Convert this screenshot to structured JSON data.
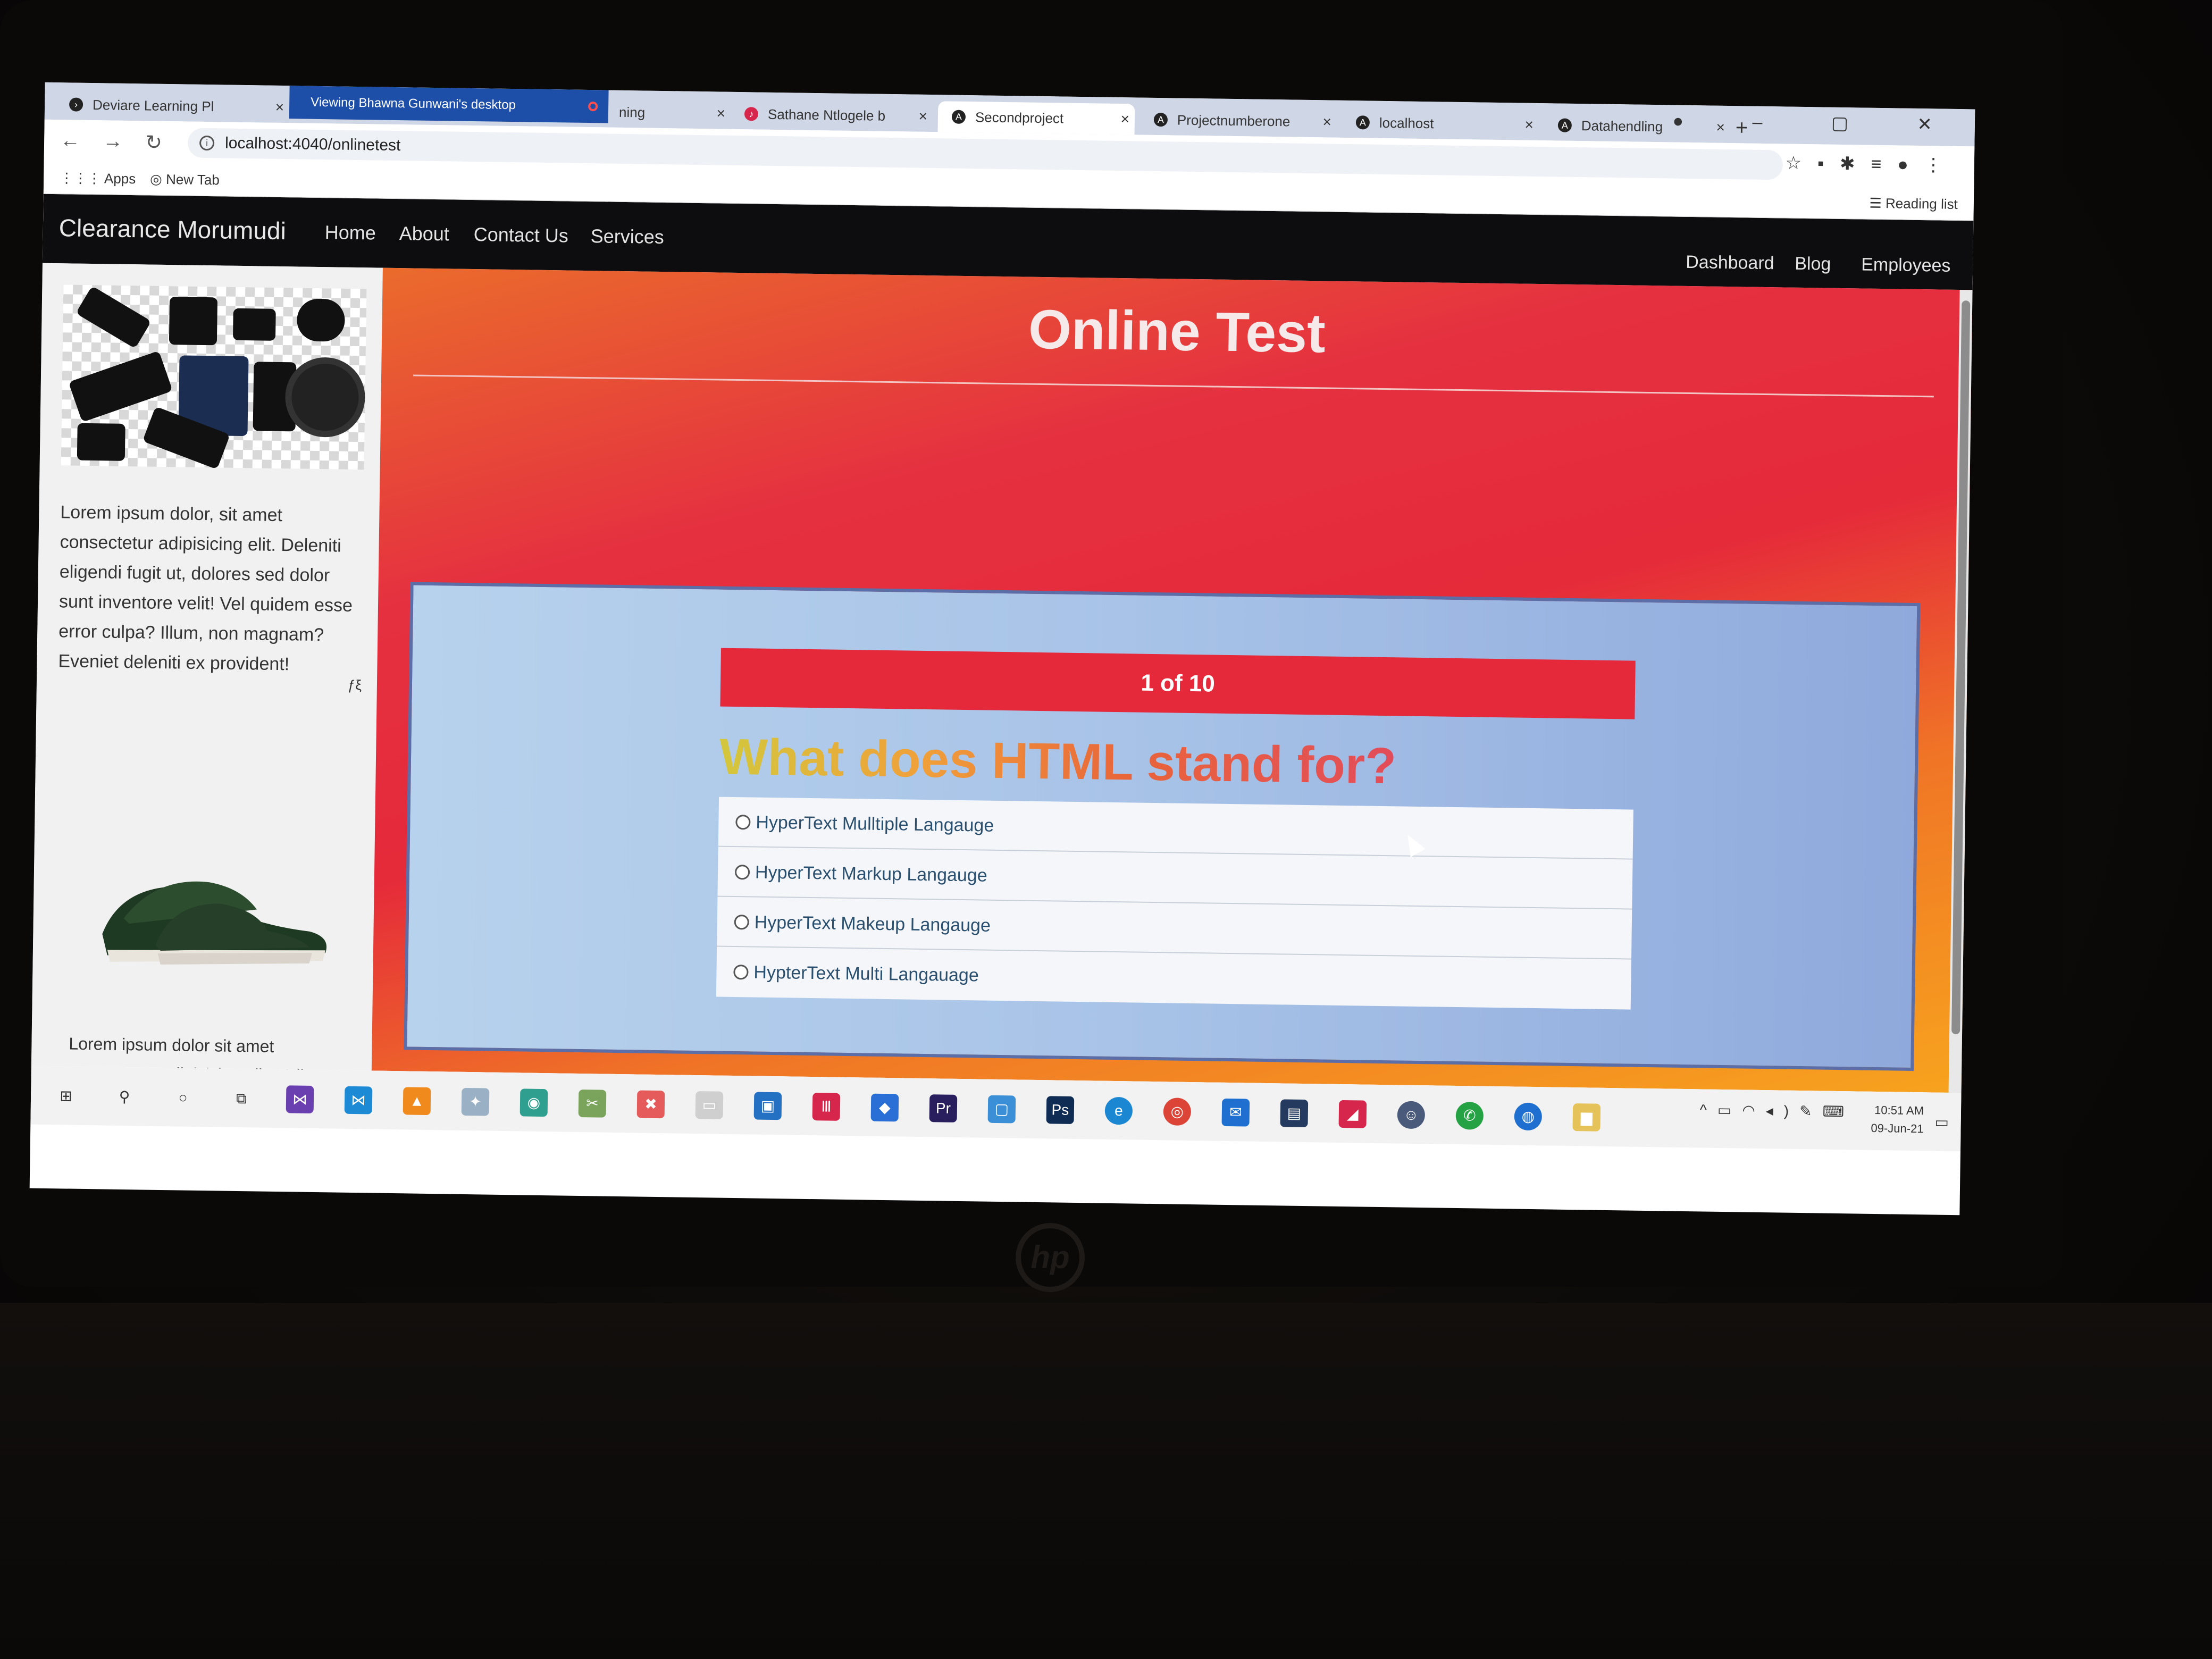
{
  "browser": {
    "tabs": [
      {
        "label": "Deviare Learning Pl",
        "favicon": "deviare-logo-icon"
      },
      {
        "label": "ning",
        "favicon": ""
      },
      {
        "label": "Sathane Ntlogele b",
        "favicon": "music-icon"
      },
      {
        "label": "Secondproject",
        "favicon": "angular-icon",
        "active": true
      },
      {
        "label": "Projectnumberone",
        "favicon": "angular-icon"
      },
      {
        "label": "localhost",
        "favicon": "angular-icon"
      },
      {
        "label": "Datahendling",
        "favicon": "angular-icon"
      }
    ],
    "share_banner": "Viewing Bhawna Gunwani's desktop",
    "url": "localhost:4040/onlinetest",
    "bookmarks": {
      "apps": "Apps",
      "new_tab": "New Tab",
      "reading_list": "Reading list"
    }
  },
  "site": {
    "brand": "Clearance Morumudi",
    "nav_left": [
      "Home",
      "About",
      "Contact Us",
      "Services"
    ],
    "nav_right": [
      "Dashboard",
      "Blog",
      "Employees"
    ]
  },
  "sidebar": {
    "text1": "Lorem ipsum dolor, sit amet consectetur adipisicing elit. Deleniti eligendi fugit ut, dolores sed dolor sunt inventore velit! Vel quidem esse error culpa? Illum, non magnam? Eveniet deleniti ex provident!",
    "text2": "Lorem ipsum dolor sit amet consectetur adipisicing elit. Velit, quo. Quidem ipsam facilis"
  },
  "main": {
    "title": "Online Test",
    "progress": "1 of 10",
    "question": "What does HTML stand for?",
    "options": [
      "HyperText Mulltiple Langauge",
      "HyperText Markup Langauge",
      "HyperText Makeup Langauge",
      "HypterText Multi Langauage"
    ]
  },
  "taskbar": {
    "time": "10:51 AM",
    "date": "09-Jun-21"
  },
  "colors": {
    "navbar": "#0d0d0f",
    "progress": "#e5283a",
    "main_gradient_start": "#ea6b2c",
    "main_gradient_mid": "#e52a3a",
    "main_gradient_end": "#f7a31e"
  }
}
